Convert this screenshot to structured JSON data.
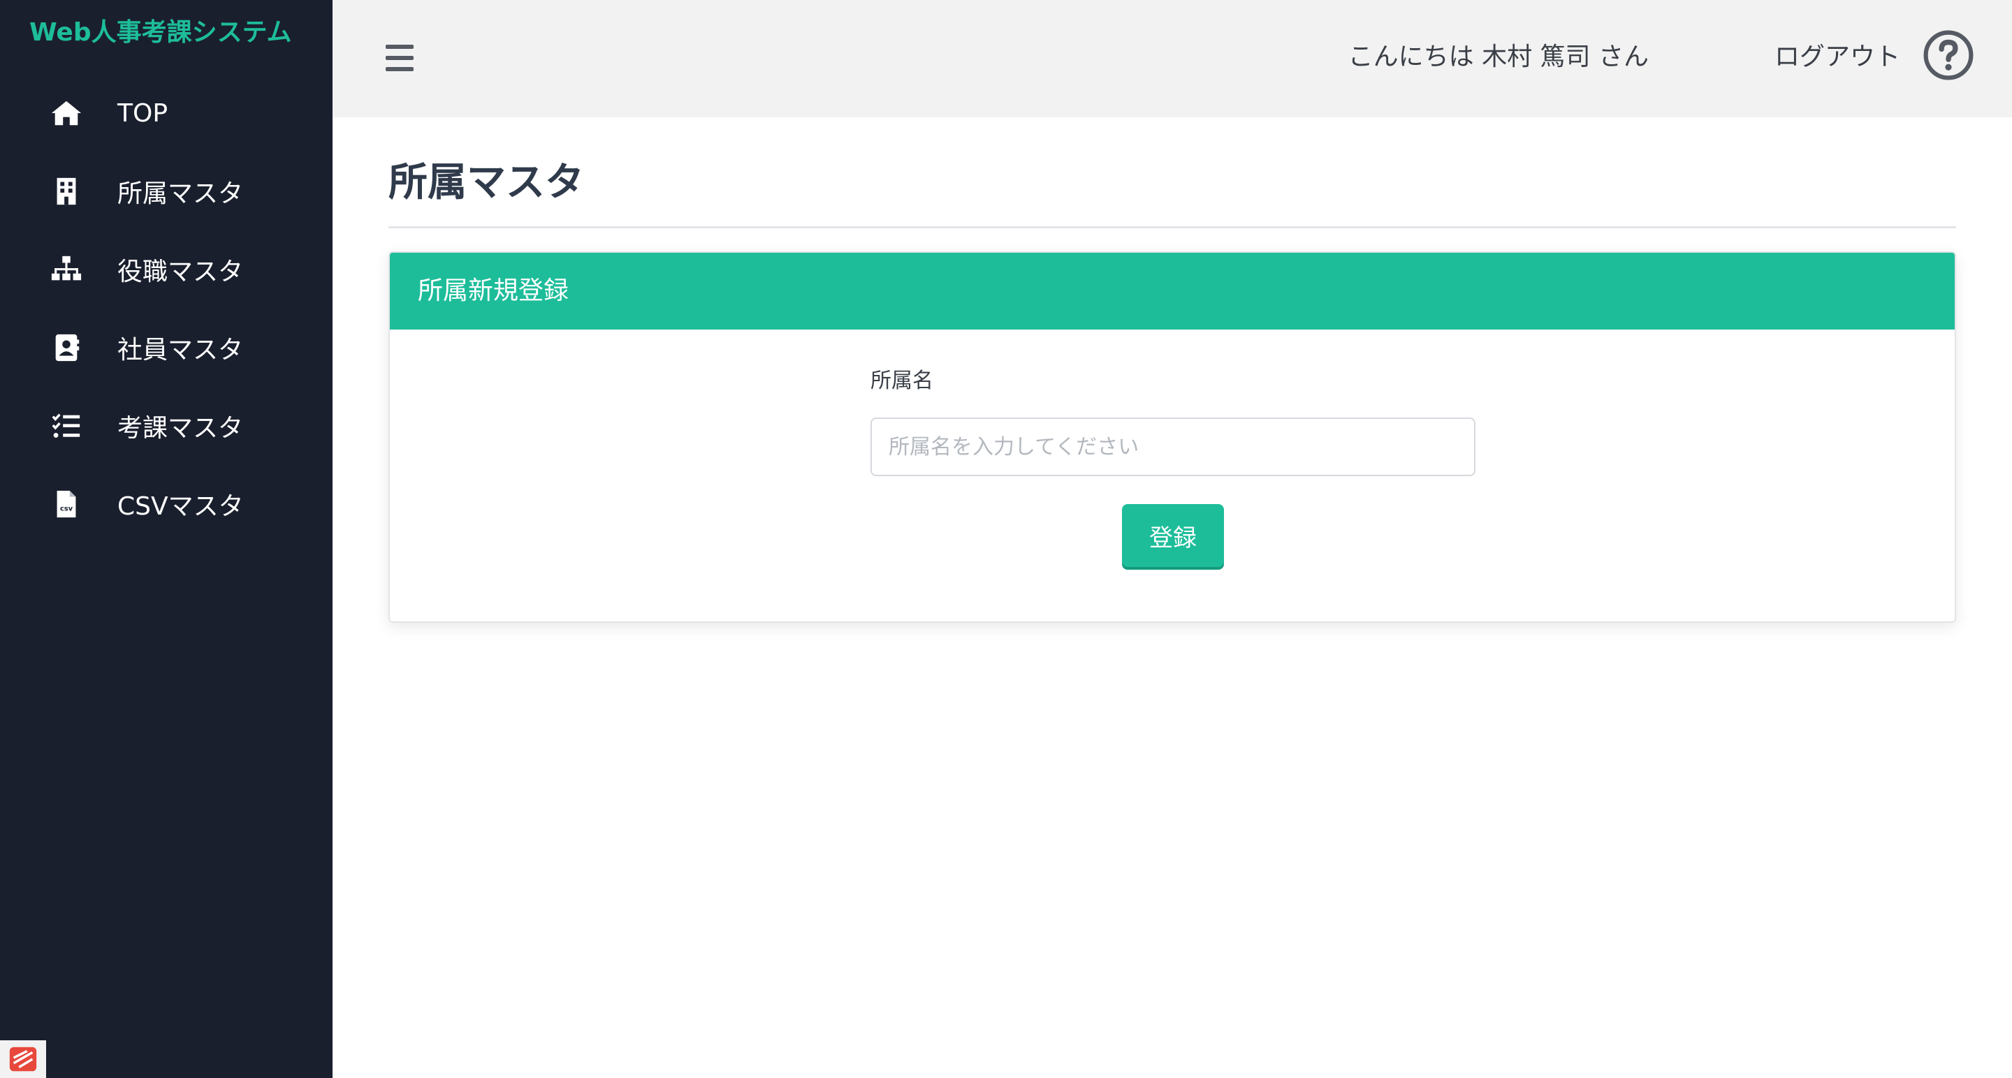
{
  "app": {
    "brand": "Web人事考課システム"
  },
  "sidebar": {
    "items": [
      {
        "label": "TOP",
        "icon": "home-icon"
      },
      {
        "label": "所属マスタ",
        "icon": "building-icon"
      },
      {
        "label": "役職マスタ",
        "icon": "sitemap-icon"
      },
      {
        "label": "社員マスタ",
        "icon": "address-card-icon"
      },
      {
        "label": "考課マスタ",
        "icon": "task-list-icon"
      },
      {
        "label": "CSVマスタ",
        "icon": "csv-file-icon"
      }
    ]
  },
  "header": {
    "greeting": "こんにちは 木村 篤司 さん",
    "logout_label": "ログアウト",
    "help_icon": "question-circle-icon",
    "menu_icon": "hamburger-icon"
  },
  "main": {
    "page_title": "所属マスタ",
    "card": {
      "title": "所属新規登録",
      "field_label": "所属名",
      "input_value": "",
      "input_placeholder": "所属名を入力してください",
      "submit_label": "登録"
    }
  },
  "colors": {
    "accent": "#1dbd9a",
    "sidebar_bg": "#1a1f2e",
    "header_bg": "#f2f2f2",
    "title_text": "#2f3a4b"
  }
}
